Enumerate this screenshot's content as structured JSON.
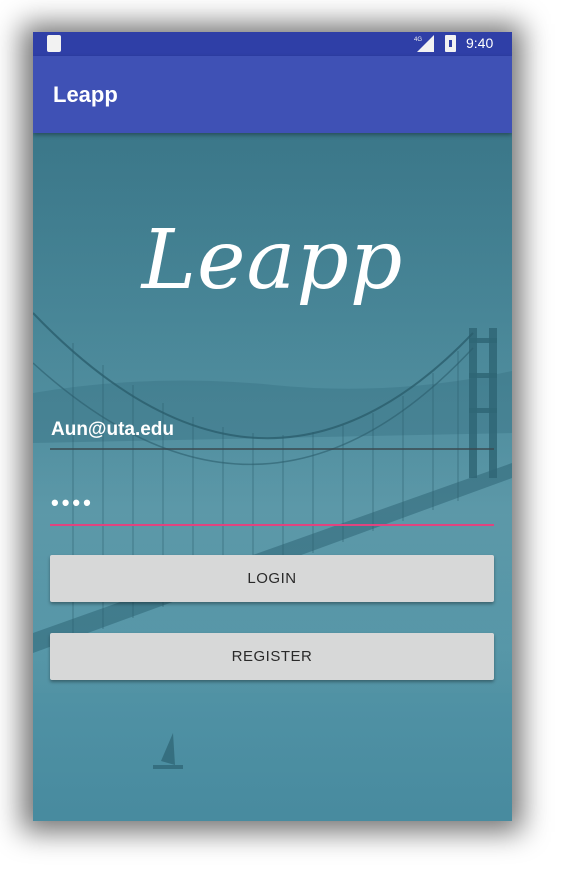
{
  "status_bar": {
    "time": "9:40",
    "icons": [
      "notification-icon",
      "signal-4g-icon",
      "battery-icon"
    ]
  },
  "app_bar": {
    "title": "Leapp",
    "color": "#3f51b5"
  },
  "logo": {
    "text": "Leapp"
  },
  "form": {
    "email_value": "Aun@uta.edu",
    "password_value": "••••",
    "accent_color": "#e0447f"
  },
  "buttons": {
    "login_label": "LOGIN",
    "register_label": "REGISTER"
  }
}
